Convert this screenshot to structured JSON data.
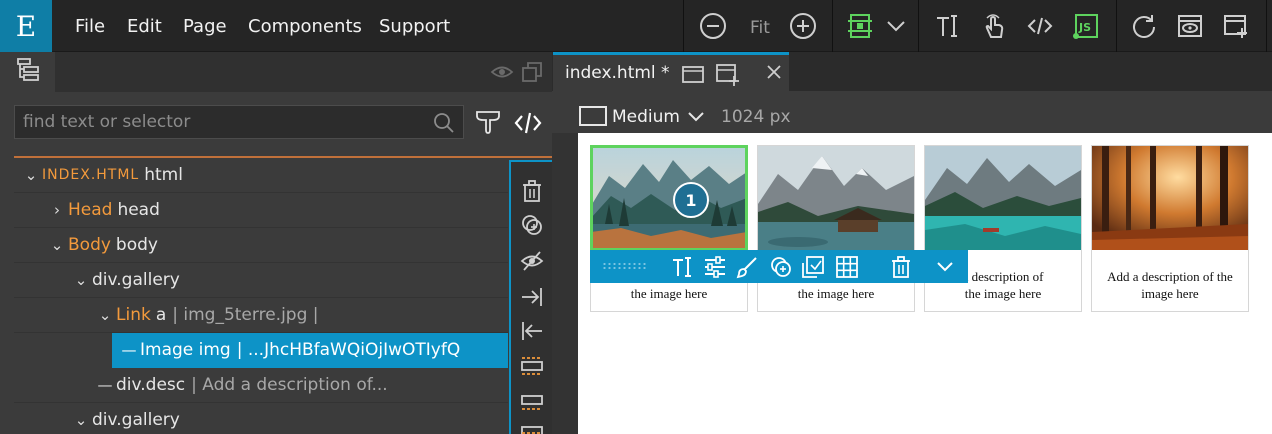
{
  "app": {
    "logo_letter": "E",
    "brand_color": "#0f7ea6",
    "accent_color": "#0d93c7",
    "tag_color": "#f39a3c",
    "selection_outline_color": "#5ed35e"
  },
  "menu": [
    "File",
    "Edit",
    "Page",
    "Components",
    "Support"
  ],
  "toolbar": {
    "zoom_label": "Fit",
    "icons": [
      "zoom-out-icon",
      "zoom-in-icon",
      "layout-mode-icon",
      "dropdown-chevron-icon",
      "text-tool-icon",
      "interactive-mode-icon",
      "code-icon",
      "javascript-icon",
      "refresh-icon",
      "preview-icon",
      "add-page-icon"
    ]
  },
  "left_panel": {
    "search_placeholder": "find text or selector",
    "tree": [
      {
        "tag": "INDEX.HTML",
        "name": "html",
        "attr": "",
        "chevron": "down",
        "level": 0
      },
      {
        "tag": "Head",
        "name": "head",
        "attr": "",
        "chevron": "right",
        "level": 1
      },
      {
        "tag": "Body",
        "name": "body",
        "attr": "",
        "chevron": "down",
        "level": 1
      },
      {
        "tag": "",
        "name": "div.gallery",
        "attr": "",
        "chevron": "down",
        "level": 2
      },
      {
        "tag": "Link",
        "name": "a",
        "attr": "| img_5terre.jpg |",
        "chevron": "down",
        "level": 3
      },
      {
        "tag": "",
        "name": "Image img",
        "attr": "| ...JhcHBfaWQiOjIwOTIyfQ",
        "chevron": "dash",
        "level": 4,
        "selected": true
      },
      {
        "tag": "",
        "name": "div.desc",
        "attr": "| Add a description of...",
        "chevron": "dash",
        "level": 3
      },
      {
        "tag": "",
        "name": "div.gallery",
        "attr": "",
        "chevron": "down",
        "level": 2
      }
    ],
    "side_tools": [
      "delete-icon",
      "duplicate-icon",
      "hide-icon",
      "move-in-icon",
      "move-out-icon",
      "wrap-icon",
      "unwrap-icon",
      "more-icon"
    ]
  },
  "document": {
    "tab_title": "index.html *",
    "device": "Medium",
    "width_label": "1024 px"
  },
  "gallery": {
    "cards": [
      {
        "desc": "Add a description of the image here",
        "image": "lake-mountains",
        "selected": true
      },
      {
        "desc": "Add a description of the image here",
        "image": "boathouse-lake"
      },
      {
        "desc": "Add a description of the image here",
        "image": "turquoise-lake"
      },
      {
        "desc": "Add a description of the image here",
        "image": "autumn-forest"
      }
    ],
    "badge_number": "1",
    "card1_visible_desc": "the image here",
    "card2_visible_desc": "the image here",
    "card3_visible_desc_line1": "a description of",
    "card3_visible_desc_line2": "the image here"
  }
}
